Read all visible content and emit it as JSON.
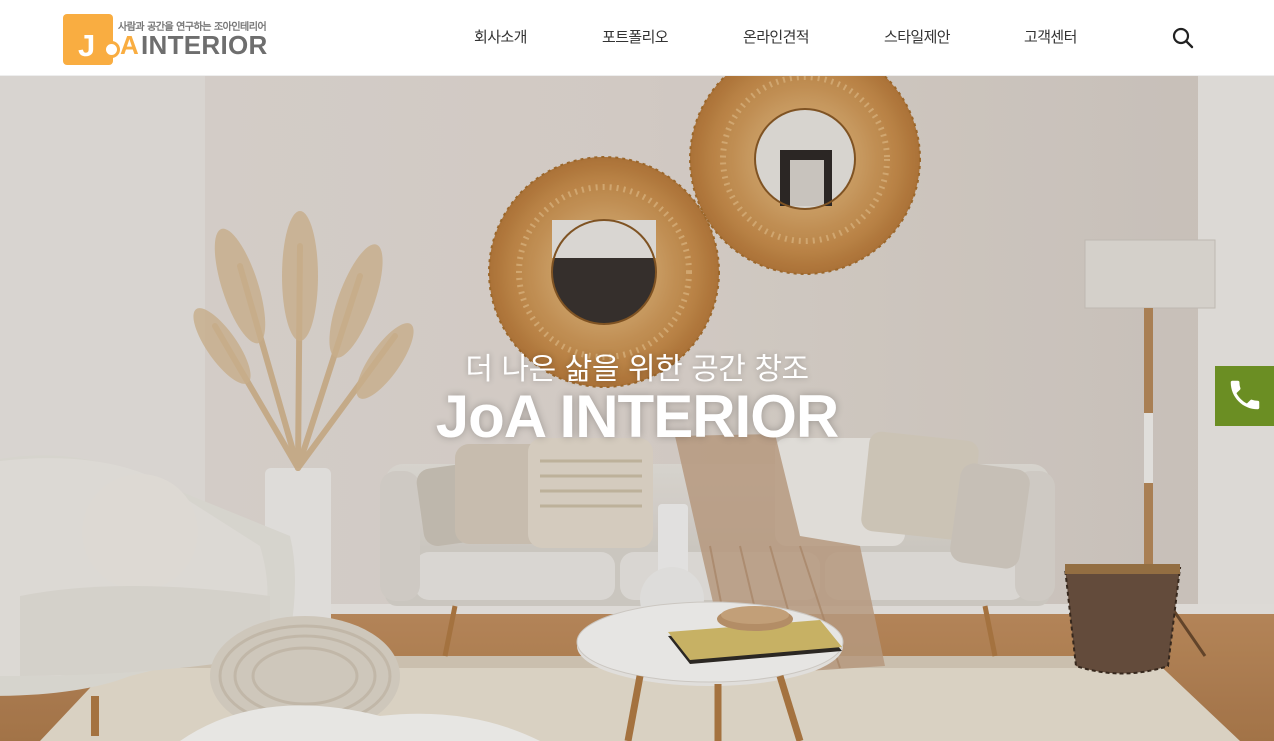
{
  "brand": {
    "tagline": "사람과 공간을 연구하는 조아인테리어",
    "logo_j": "J",
    "logo_a": "A",
    "logo_rest": "INTERIOR",
    "accent_color": "#f9ad41",
    "gray_color": "#6e6e6e"
  },
  "nav": {
    "items": [
      {
        "label": "회사소개"
      },
      {
        "label": "포트폴리오"
      },
      {
        "label": "온라인견적"
      },
      {
        "label": "스타일제안"
      },
      {
        "label": "고객센터"
      }
    ],
    "search_icon": "search-icon"
  },
  "hero": {
    "subtitle": "더 나은 삶을 위한 공간 창조",
    "title": "JoA INTERIOR"
  },
  "floating": {
    "call_icon": "phone-icon",
    "call_color": "#6b8e23"
  }
}
